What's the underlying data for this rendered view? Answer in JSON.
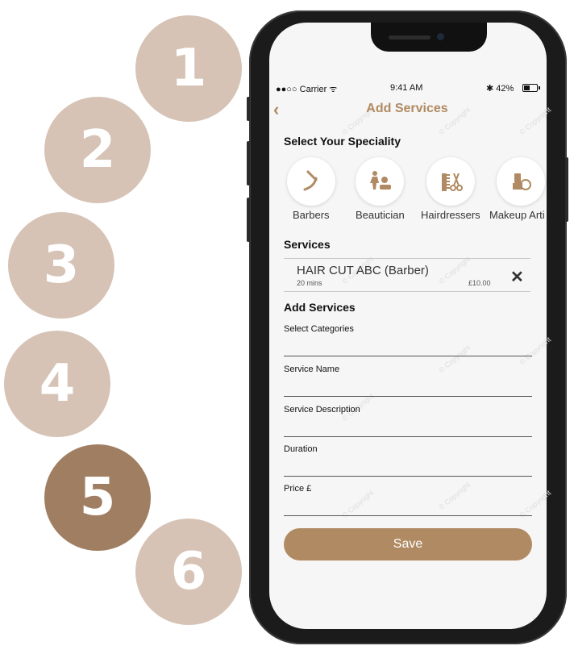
{
  "steps": [
    "1",
    "2",
    "3",
    "4",
    "5",
    "6"
  ],
  "status_bar": {
    "carrier": "●●○○ Carrier ᯤ",
    "time": "9:41 AM",
    "battery": "✱ 42%"
  },
  "nav": {
    "back_icon": "chevron-left-icon",
    "title": "Add Services"
  },
  "speciality": {
    "heading": "Select Your Speciality",
    "items": [
      {
        "label": "Barbers",
        "icon": "razor-icon"
      },
      {
        "label": "Beautician",
        "icon": "beautician-icon"
      },
      {
        "label": "Hairdressers",
        "icon": "comb-scissors-icon"
      },
      {
        "label": "Makeup Arti",
        "icon": "makeup-icon"
      }
    ]
  },
  "services": {
    "heading": "Services",
    "items": [
      {
        "name": "HAIR CUT ABC (Barber)",
        "duration": "20 mins",
        "price": "£10.00"
      }
    ]
  },
  "add_services": {
    "heading": "Add Services",
    "fields": [
      {
        "label": "Select Categories"
      },
      {
        "label": "Service Name"
      },
      {
        "label": "Service Description"
      },
      {
        "label": "Duration"
      },
      {
        "label": "Price £"
      }
    ]
  },
  "save_label": "Save",
  "watermark": "© Copyright",
  "colors": {
    "accent": "#b08a62",
    "step": "#d6c3b5",
    "step_active": "#a07e62"
  }
}
